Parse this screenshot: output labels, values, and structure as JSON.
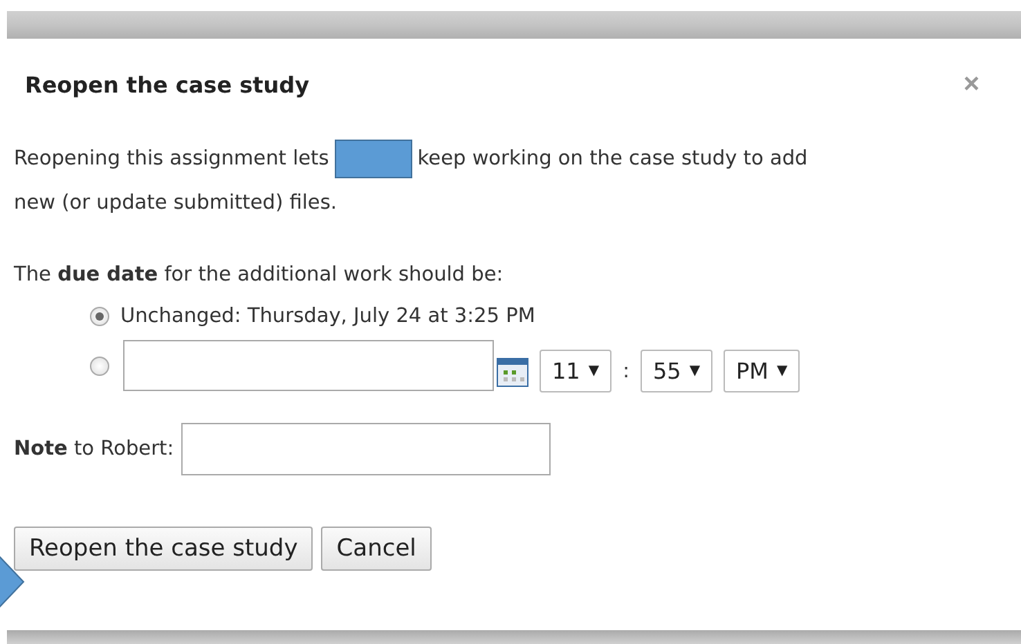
{
  "dialog": {
    "title": "Reopen the case study",
    "close": "×"
  },
  "intro": {
    "before": "Reopening this assignment lets",
    "after": "keep working on the case study to add",
    "continued": "new (or update submitted) files."
  },
  "due_prompt": "The **due date** for the additional work should be:",
  "options": [
    {
      "kind": "text",
      "label": "Unchanged: Thursday, July 24 at 3:25 PM",
      "selected": true
    },
    {
      "kind": "custom",
      "selected": false,
      "hour": "11",
      "minute": "55",
      "period": "PM",
      "separator": ":",
      "caret": "▼"
    }
  ],
  "note": {
    "label": "**Note** to Robert:"
  },
  "buttons": [
    "Reopen the case study",
    "Cancel"
  ]
}
